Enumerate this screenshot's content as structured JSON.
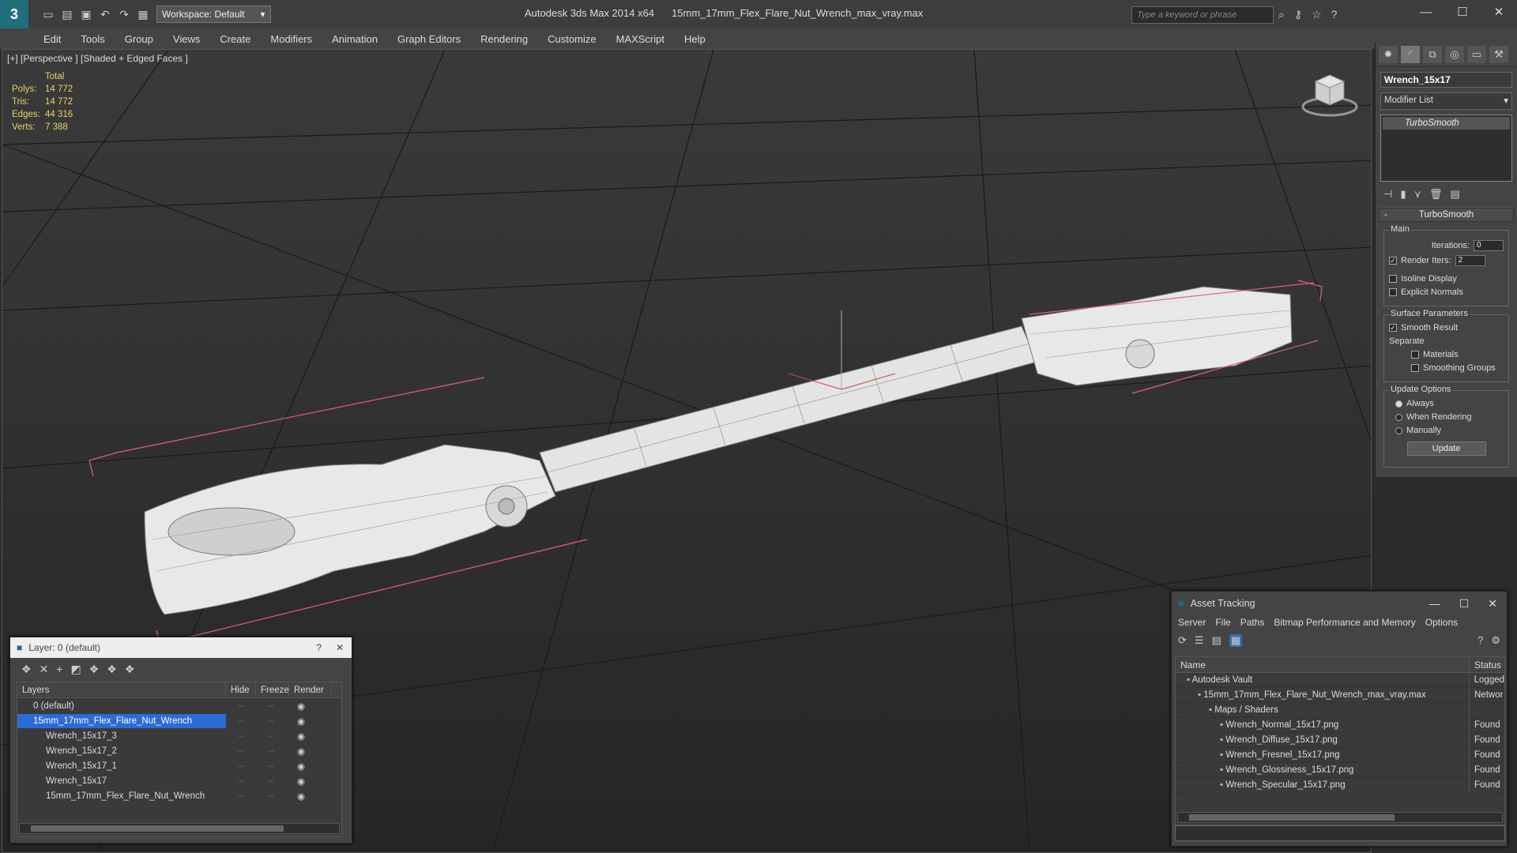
{
  "app": {
    "title": "Autodesk 3ds Max  2014 x64",
    "file": "15mm_17mm_Flex_Flare_Nut_Wrench_max_vray.max",
    "workspace": "Workspace: Default",
    "search_placeholder": "Type a keyword or phrase"
  },
  "menu": [
    "Edit",
    "Tools",
    "Group",
    "Views",
    "Create",
    "Modifiers",
    "Animation",
    "Graph Editors",
    "Rendering",
    "Customize",
    "MAXScript",
    "Help"
  ],
  "viewport": {
    "label": "[+] [Perspective ] [Shaded + Edged Faces ]",
    "stats_header": "Total",
    "stats": [
      {
        "k": "Polys:",
        "v": "14 772"
      },
      {
        "k": "Tris:",
        "v": "14 772"
      },
      {
        "k": "Edges:",
        "v": "44 316"
      },
      {
        "k": "Verts:",
        "v": "7 388"
      }
    ]
  },
  "command_panel": {
    "object_name": "Wrench_15x17",
    "modifier_list": "Modifier List",
    "stack_item": "TurboSmooth",
    "rollout_title": "TurboSmooth",
    "main_group": "Main",
    "iterations_label": "Iterations:",
    "iterations_value": "0",
    "render_iters_label": "Render Iters:",
    "render_iters_value": "2",
    "isoline": "Isoline Display",
    "explicit": "Explicit Normals",
    "surface_group": "Surface Parameters",
    "smooth_result": "Smooth Result",
    "separate": "Separate",
    "materials": "Materials",
    "smoothing_groups": "Smoothing Groups",
    "update_group": "Update Options",
    "always": "Always",
    "when_rendering": "When Rendering",
    "manually": "Manually",
    "update_btn": "Update"
  },
  "layer_window": {
    "title": "Layer: 0 (default)",
    "help": "?",
    "columns": {
      "layers": "Layers",
      "hide": "Hide",
      "freeze": "Freeze",
      "render": "Render"
    },
    "rows": [
      {
        "name": "0 (default)",
        "child": false,
        "sel": false
      },
      {
        "name": "15mm_17mm_Flex_Flare_Nut_Wrench",
        "child": false,
        "sel": true
      },
      {
        "name": "Wrench_15x17_3",
        "child": true,
        "sel": false
      },
      {
        "name": "Wrench_15x17_2",
        "child": true,
        "sel": false
      },
      {
        "name": "Wrench_15x17_1",
        "child": true,
        "sel": false
      },
      {
        "name": "Wrench_15x17",
        "child": true,
        "sel": false
      },
      {
        "name": "15mm_17mm_Flex_Flare_Nut_Wrench",
        "child": true,
        "sel": false
      }
    ]
  },
  "asset_window": {
    "title": "Asset Tracking",
    "menu": [
      "Server",
      "File",
      "Paths",
      "Bitmap Performance and Memory",
      "Options"
    ],
    "columns": {
      "name": "Name",
      "status": "Status"
    },
    "rows": [
      {
        "name": "Autodesk Vault",
        "indent": 1,
        "status": "Logged"
      },
      {
        "name": "15mm_17mm_Flex_Flare_Nut_Wrench_max_vray.max",
        "indent": 2,
        "status": "Networ"
      },
      {
        "name": "Maps / Shaders",
        "indent": 3,
        "status": ""
      },
      {
        "name": "Wrench_Normal_15x17.png",
        "indent": 4,
        "status": "Found"
      },
      {
        "name": "Wrench_Diffuse_15x17.png",
        "indent": 4,
        "status": "Found"
      },
      {
        "name": "Wrench_Fresnel_15x17.png",
        "indent": 4,
        "status": "Found"
      },
      {
        "name": "Wrench_Glossiness_15x17.png",
        "indent": 4,
        "status": "Found"
      },
      {
        "name": "Wrench_Specular_15x17.png",
        "indent": 4,
        "status": "Found"
      }
    ]
  }
}
